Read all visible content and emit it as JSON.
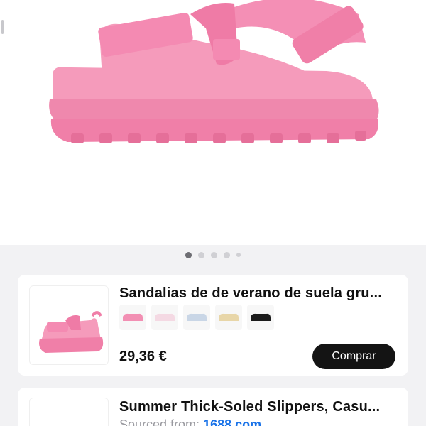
{
  "colors": {
    "sandal_pink": "#f28fb3",
    "page_background": "#f2f2f4",
    "button_dark": "#141414",
    "link_blue": "#1a73e8"
  },
  "gallery": {
    "image": "pink-platform-sandal-photo",
    "pages": 5,
    "active_page": 1
  },
  "results": [
    {
      "title": "Sandalias de de verano de suela gru...",
      "price": "29,36 €",
      "button_label": "Comprar",
      "variant_colors": [
        "#f28fb3",
        "#f4d9e3",
        "#c9d6e6",
        "#e8d6a8",
        "#1b1b1b"
      ]
    },
    {
      "title": "Summer Thick-Soled Slippers, Casu...",
      "source_label": "Sourced from:",
      "source_link": "1688.com"
    }
  ]
}
